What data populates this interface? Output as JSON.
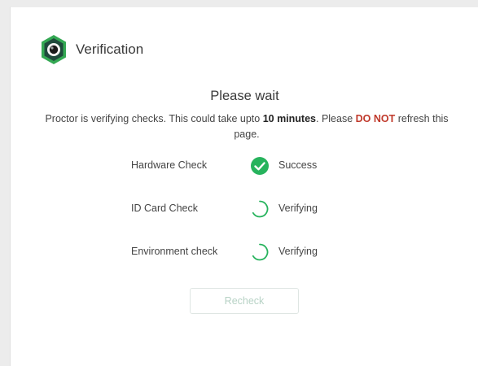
{
  "header": {
    "title": "Verification",
    "icon": "camera-lens-icon"
  },
  "status": {
    "title": "Please wait",
    "message_prefix": "Proctor is verifying checks. This could take upto ",
    "duration": "10 minutes",
    "message_middle": ". Please ",
    "warning": "DO NOT",
    "message_suffix": " refresh this page."
  },
  "checks": [
    {
      "label": "Hardware Check",
      "status": "Success",
      "state": "success",
      "icon": "check-circle-icon"
    },
    {
      "label": "ID Card Check",
      "status": "Verifying",
      "state": "verifying",
      "icon": "spinner-icon"
    },
    {
      "label": "Environment check",
      "status": "Verifying",
      "state": "verifying",
      "icon": "spinner-icon"
    }
  ],
  "actions": {
    "recheck_label": "Recheck",
    "recheck_disabled": true
  },
  "colors": {
    "accent_green": "#27b35d",
    "warning_red": "#c0392b",
    "logo_dark": "#1f4a3c",
    "logo_green": "#34a853"
  }
}
